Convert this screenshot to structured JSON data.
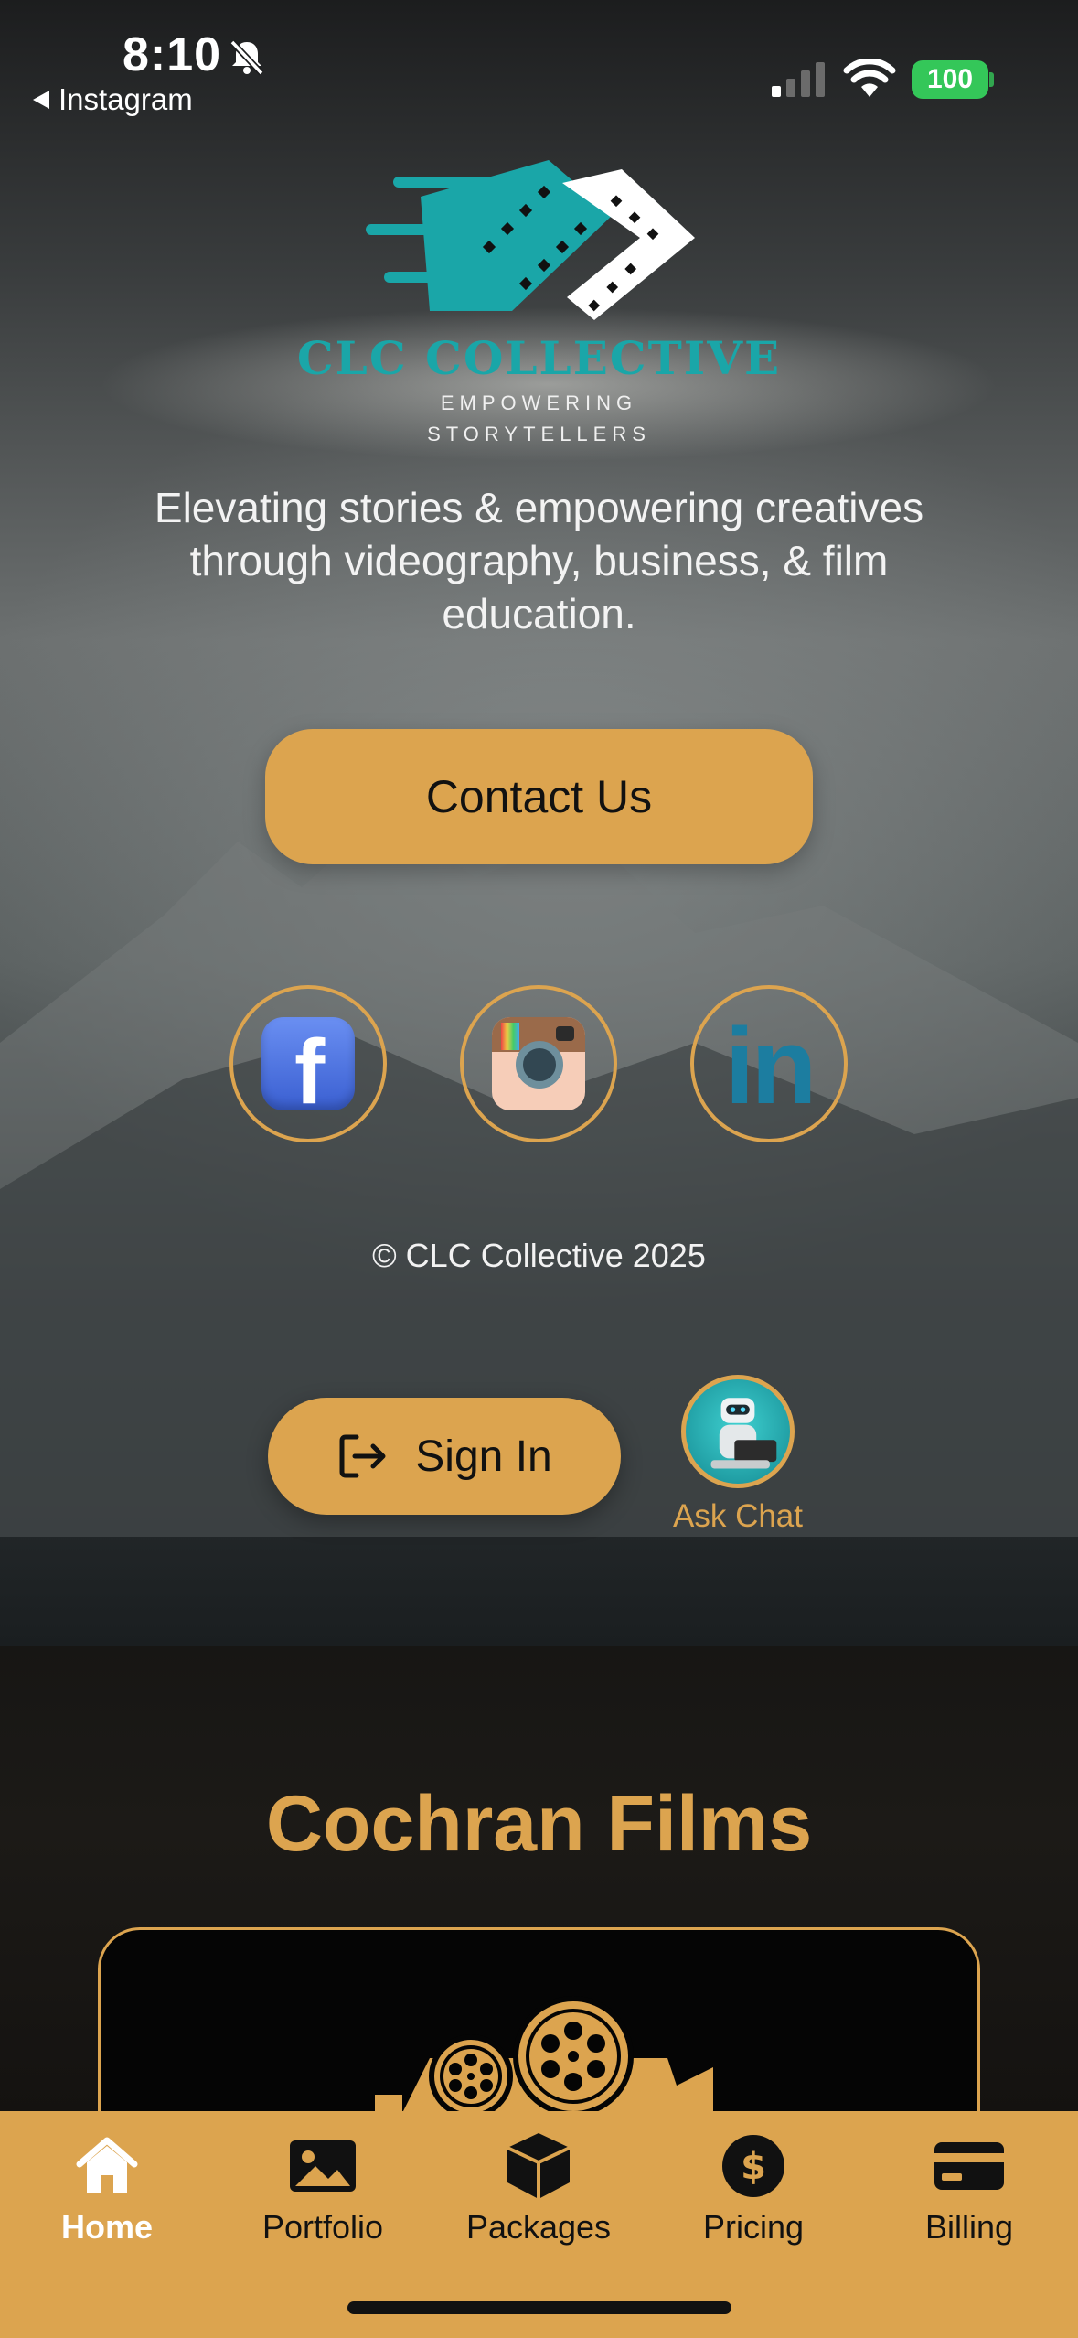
{
  "status_bar": {
    "time": "8:10",
    "back_app": "Instagram",
    "battery": "100"
  },
  "brand": {
    "name": "CLC COLLECTIVE",
    "tag_line1": "EMPOWERING",
    "tag_line2": "STORYTELLERS",
    "accent_teal": "#1aa6a8",
    "accent_gold": "#dca44f"
  },
  "hero": {
    "tagline": "Elevating stories & empowering creatives through videography, business, & film education.",
    "contact_label": "Contact Us"
  },
  "social": [
    {
      "name": "facebook-icon"
    },
    {
      "name": "instagram-icon"
    },
    {
      "name": "linkedin-icon",
      "glyph": "in"
    }
  ],
  "footer": {
    "copyright": "© CLC Collective 2025"
  },
  "auth": {
    "signin_label": "Sign In",
    "chat_label": "Ask Chat"
  },
  "section": {
    "title": "Cochran Films"
  },
  "tabs": [
    {
      "label": "Home",
      "icon": "home-icon",
      "active": true
    },
    {
      "label": "Portfolio",
      "icon": "image-icon",
      "active": false
    },
    {
      "label": "Packages",
      "icon": "box-icon",
      "active": false
    },
    {
      "label": "Pricing",
      "icon": "dollar-icon",
      "active": false
    },
    {
      "label": "Billing",
      "icon": "credit-card-icon",
      "active": false
    }
  ]
}
